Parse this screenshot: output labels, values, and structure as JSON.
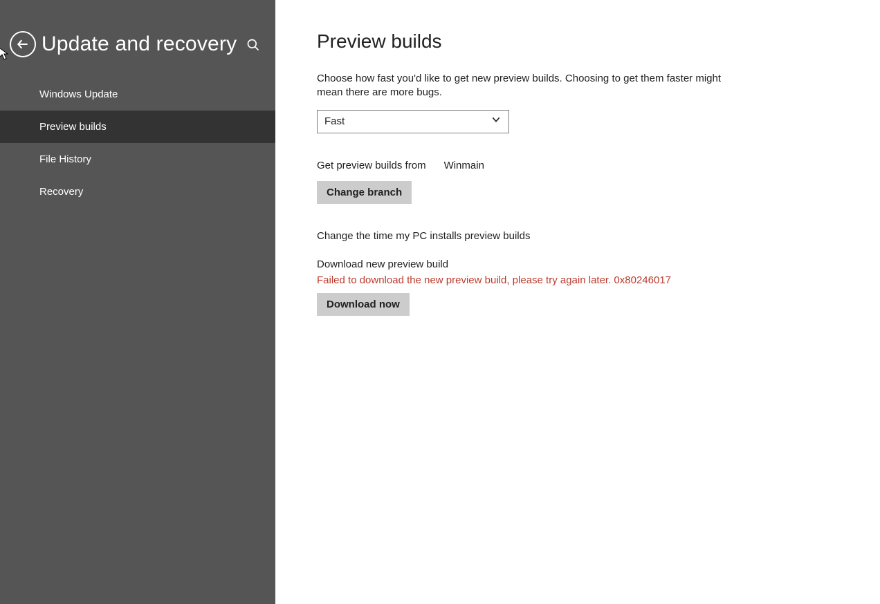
{
  "sidebar": {
    "title": "Update and recovery",
    "items": [
      {
        "label": "Windows Update",
        "active": false
      },
      {
        "label": "Preview builds",
        "active": true
      },
      {
        "label": "File History",
        "active": false
      },
      {
        "label": "Recovery",
        "active": false
      }
    ]
  },
  "main": {
    "title": "Preview builds",
    "description": "Choose how fast you'd like to get new preview builds. Choosing to get them faster might mean there are more bugs.",
    "dropdown": {
      "value": "Fast"
    },
    "branch": {
      "label": "Get preview builds from",
      "value": "Winmain",
      "button": "Change branch"
    },
    "install_time_link": "Change the time my PC installs preview builds",
    "download": {
      "heading": "Download new preview build",
      "error": "Failed to download the new preview build, please try again later. 0x80246017",
      "button": "Download now"
    }
  }
}
